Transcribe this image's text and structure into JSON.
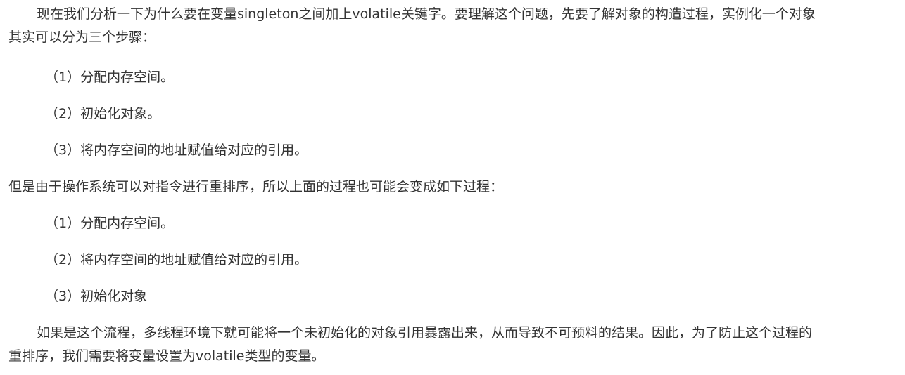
{
  "article": {
    "para1": {
      "line1": "现在我们分析一下为什么要在变量singleton之间加上volatile关键字。要理解这个问题，先要了解对象的构造过程，实例化一个对象",
      "line2": "其实可以分为三个步骤："
    },
    "steps1": [
      "（1）分配内存空间。",
      "（2）初始化对象。",
      "（3）将内存空间的地址赋值给对应的引用。"
    ],
    "para2": "但是由于操作系统可以对指令进行重排序，所以上面的过程也可能会变成如下过程：",
    "steps2": [
      "（1）分配内存空间。",
      "（2）将内存空间的地址赋值给对应的引用。",
      "（3）初始化对象"
    ],
    "para3": {
      "line1": "如果是这个流程，多线程环境下就可能将一个未初始化的对象引用暴露出来，从而导致不可预料的结果。因此，为了防止这个过程的",
      "line2": "重排序，我们需要将变量设置为volatile类型的变量。"
    }
  }
}
